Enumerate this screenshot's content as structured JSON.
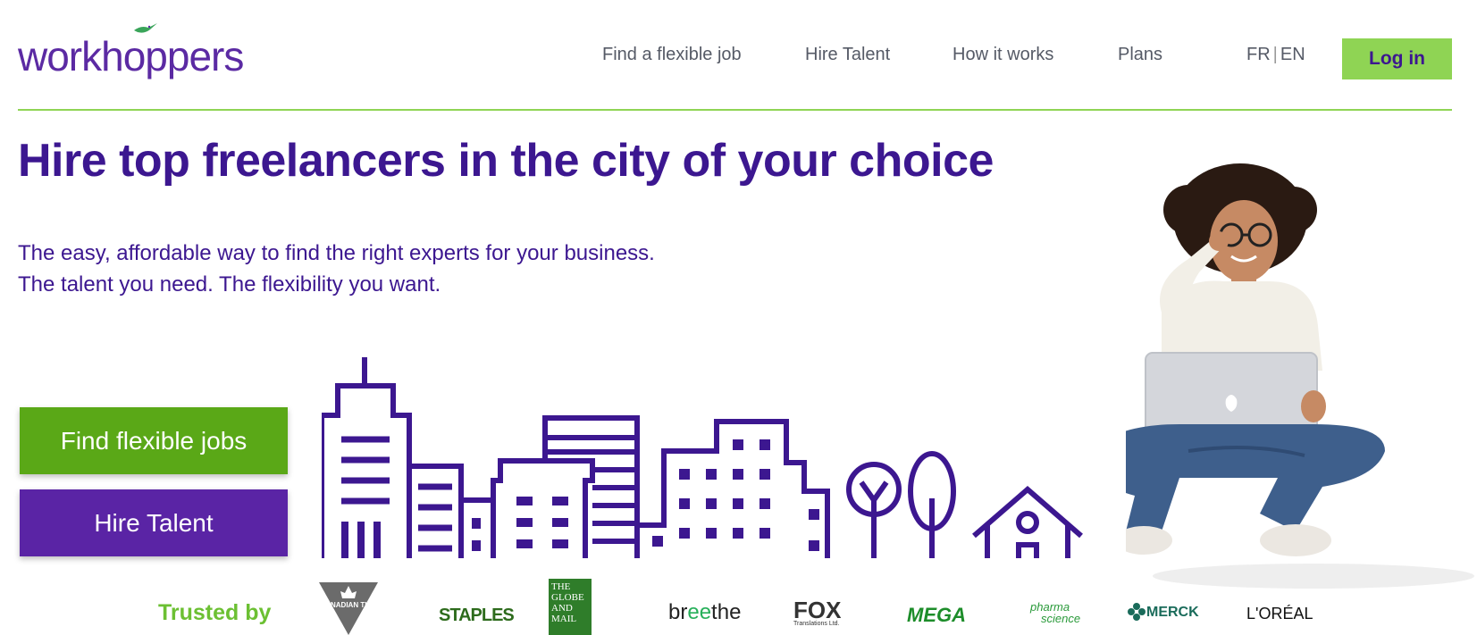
{
  "brand": {
    "logo_text": "workhoppers"
  },
  "nav": {
    "links": [
      "Find a flexible job",
      "Hire Talent",
      "How it works",
      "Plans"
    ],
    "lang_fr": "FR",
    "lang_sep": "|",
    "lang_en": "EN",
    "login_label": "Log in"
  },
  "hero": {
    "title": "Hire top freelancers in the city of your choice",
    "subtitle_line1": "The easy, affordable way to find the right experts for your business.",
    "subtitle_line2": "The talent you need. The flexibility you want.",
    "cta_jobs": "Find flexible jobs",
    "cta_hire": "Hire Talent"
  },
  "trusted": {
    "label": "Trusted by",
    "logos": {
      "canadian_tire": "CANADIAN TIRE",
      "staples": "STAPLES",
      "globe": "THE GLOBE AND MAIL",
      "breethe_pre": "br",
      "breethe_ee": "ee",
      "breethe_post": "the",
      "fox": "FOX",
      "fox_sub": "Translations Ltd.",
      "mega": "MEGA",
      "pharma_line1": "pharma",
      "pharma_line2": "science",
      "merck": "MERCK",
      "loreal": "L'ORÉAL"
    }
  },
  "colors": {
    "primary_purple": "#3c1790",
    "button_purple": "#5a24a5",
    "green": "#5aa817",
    "light_green": "#8fd454"
  }
}
